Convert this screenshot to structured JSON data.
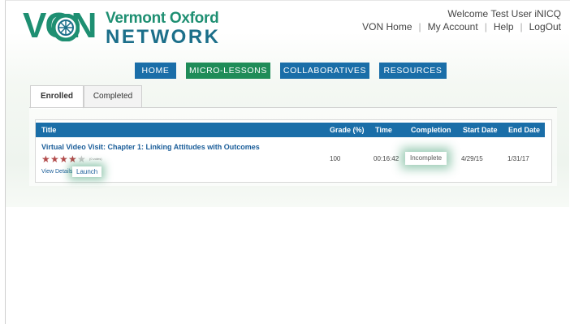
{
  "brand": {
    "logo_letters": "VON",
    "name_line1": "Vermont Oxford",
    "name_line2": "NETWORK",
    "primary_color": "#1e8f72",
    "secondary_color": "#1c6f8a"
  },
  "user": {
    "welcome_text": "Welcome Test User iNICQ"
  },
  "utility_nav": {
    "items": [
      "VON Home",
      "My Account",
      "Help",
      "LogOut"
    ],
    "separator": "|"
  },
  "main_nav": {
    "items": [
      {
        "label": "HOME",
        "active": false
      },
      {
        "label": "MICRO-LESSONS",
        "active": true
      },
      {
        "label": "COLLABORATIVES",
        "active": false
      },
      {
        "label": "RESOURCES",
        "active": false
      }
    ],
    "color": "#1a6ea8",
    "active_color": "#1f8c58"
  },
  "tabs": [
    {
      "label": "Enrolled",
      "active": true
    },
    {
      "label": "Completed",
      "active": false
    }
  ],
  "table": {
    "headers": {
      "title": "Title",
      "grade": "Grade (%)",
      "time": "Time",
      "completion": "Completion",
      "start_date": "Start Date",
      "end_date": "End Date"
    },
    "rows": [
      {
        "title": "Virtual Video Visit: Chapter 1: Linking Attitudes with Outcomes",
        "rating": 4,
        "rating_max": 5,
        "vote_count": "(0 votes)",
        "view_details": "View Details",
        "launch_label": "Launch",
        "grade": "100",
        "time": "00:16:42",
        "completion": "Incomplete",
        "start_date": "4/29/15",
        "end_date": "1/31/17"
      }
    ]
  }
}
